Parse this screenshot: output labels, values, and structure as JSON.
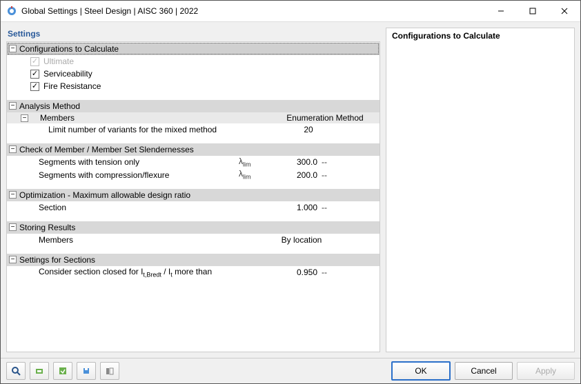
{
  "window": {
    "title": "Global Settings | Steel Design | AISC 360 | 2022"
  },
  "left_title": "Settings",
  "right_title": "Configurations to Calculate",
  "groups": {
    "configs": {
      "title": "Configurations to Calculate",
      "items": [
        {
          "label": "Ultimate",
          "checked": true,
          "disabled": true
        },
        {
          "label": "Serviceability",
          "checked": true,
          "disabled": false
        },
        {
          "label": "Fire Resistance",
          "checked": true,
          "disabled": false
        }
      ]
    },
    "analysis": {
      "title": "Analysis Method",
      "sub_title": "Members",
      "enum_header": "Enumeration Method",
      "rows": [
        {
          "label": "Limit number of variants for the mixed method",
          "value": "20"
        }
      ]
    },
    "slender": {
      "title": "Check of Member / Member Set Slendernesses",
      "sym": "λ",
      "sym_sub": "lim",
      "rows": [
        {
          "label": "Segments with tension only",
          "value": "300.0",
          "unit": "--"
        },
        {
          "label": "Segments with compression/flexure",
          "value": "200.0",
          "unit": "--"
        }
      ]
    },
    "optim": {
      "title": "Optimization - Maximum allowable design ratio",
      "rows": [
        {
          "label": "Section",
          "value": "1.000",
          "unit": "--"
        }
      ]
    },
    "storing": {
      "title": "Storing Results",
      "rows": [
        {
          "label": "Members",
          "value": "By location"
        }
      ]
    },
    "sections": {
      "title": "Settings for Sections",
      "row_prefix": "Consider section closed for I",
      "row_sub": "t,Bredt",
      "row_mid": " / I",
      "row_sub2": "t",
      "row_suffix": " more than",
      "value": "0.950",
      "unit": "--"
    }
  },
  "buttons": {
    "ok": "OK",
    "cancel": "Cancel",
    "apply": "Apply"
  },
  "toggle_glyph": "−"
}
